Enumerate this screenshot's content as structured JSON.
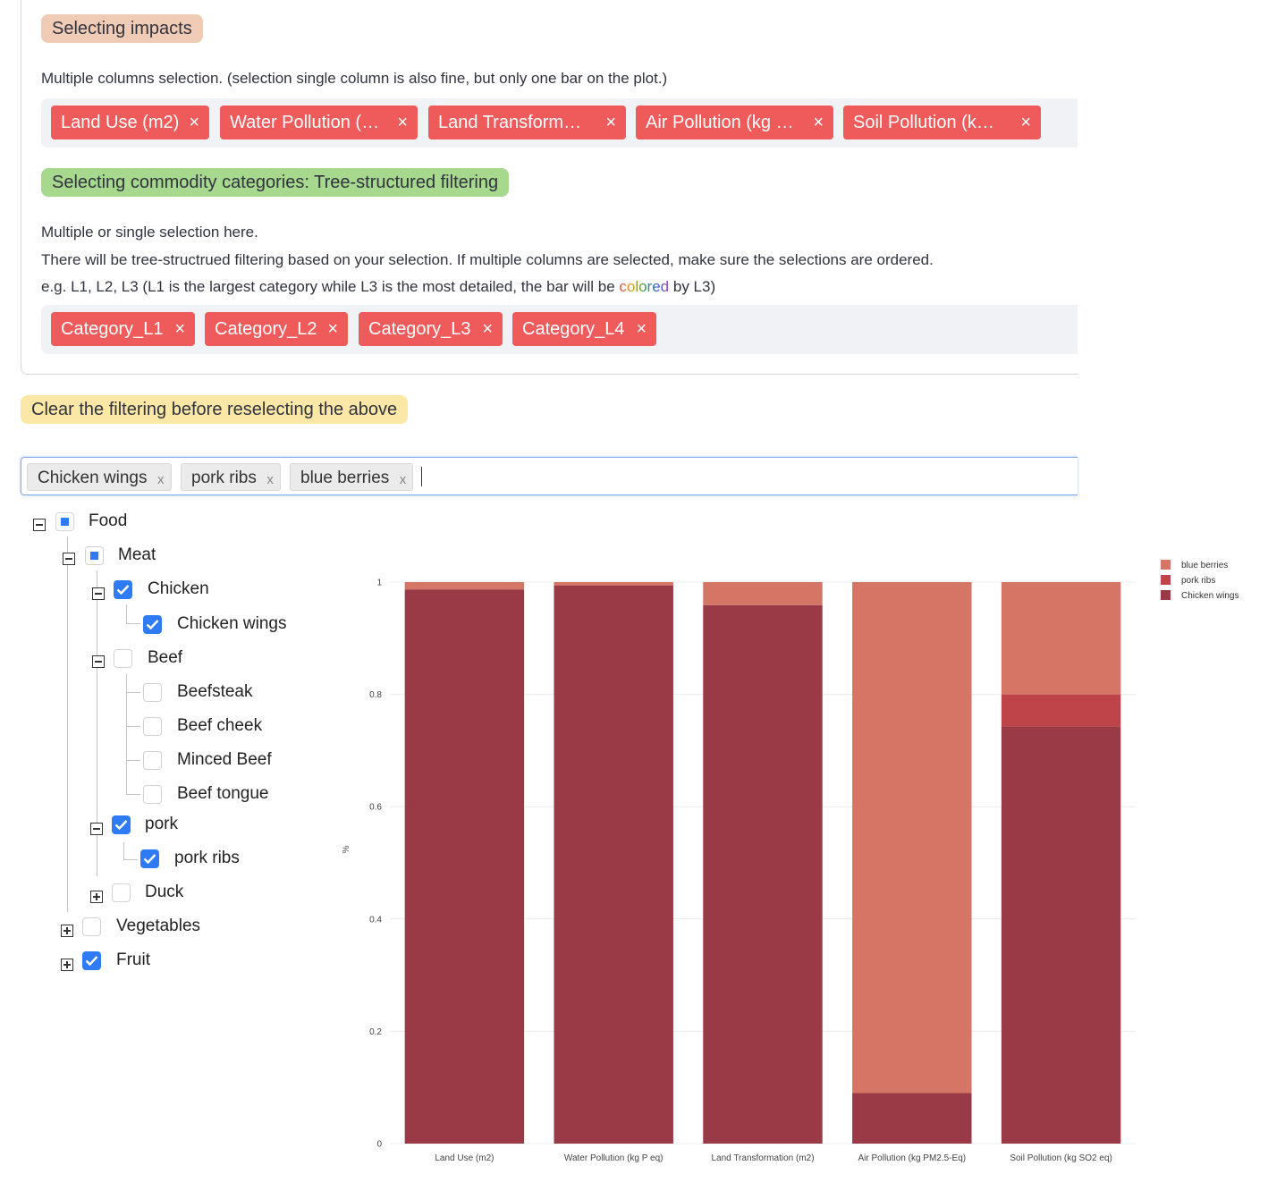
{
  "impacts_section": {
    "heading": "Selecting impacts",
    "description": "Multiple columns selection. (selection single column is also fine, but only one bar on the plot.)",
    "tags": [
      {
        "label": "Land Use (m2)"
      },
      {
        "label": "Water Pollution (…"
      },
      {
        "label": "Land Transform…"
      },
      {
        "label": "Air Pollution (kg …"
      },
      {
        "label": "Soil Pollution (k…"
      }
    ],
    "remove_glyph": "×"
  },
  "categories_section": {
    "heading": "Selecting commodity categories: Tree-structured filtering",
    "line1": "Multiple or single selection here.",
    "line2": "There will be tree-structrued filtering based on your selection. If multiple columns are selected, make sure the selections are ordered.",
    "line3_prefix": "e.g. L1, L2, L3 (L1 is the largest category while L3 is the most detailed, the bar will be ",
    "line3_colored": "colored",
    "line3_suffix": " by L3)",
    "tags": [
      {
        "label": "Category_L1"
      },
      {
        "label": "Category_L2"
      },
      {
        "label": "Category_L3"
      },
      {
        "label": "Category_L4"
      }
    ]
  },
  "filter_section": {
    "heading": "Clear the filtering before reselecting the above",
    "selected": [
      {
        "label": "Chicken wings"
      },
      {
        "label": "pork ribs"
      },
      {
        "label": "blue berries"
      }
    ],
    "remove_glyph": "x"
  },
  "tree": {
    "food": "Food",
    "meat": "Meat",
    "chicken": "Chicken",
    "chicken_wings": "Chicken wings",
    "beef": "Beef",
    "beefsteak": "Beefsteak",
    "beef_cheek": "Beef cheek",
    "minced_beef": "Minced Beef",
    "beef_tongue": "Beef tongue",
    "pork": "pork",
    "pork_ribs": "pork ribs",
    "duck": "Duck",
    "vegetables": "Vegetables",
    "fruit": "Fruit"
  },
  "colors": {
    "chicken_wings": "#9b3a47",
    "pork_ribs": "#bf4449",
    "blue_berries": "#d57566",
    "tag_red": "#ef5a5a",
    "checkbox_blue": "#2f7bf5",
    "impacts_pill": "#f0cbb5",
    "categories_pill": "#a6d88e",
    "filter_pill": "#fbe7a6"
  },
  "chart_data": {
    "type": "bar",
    "stacked": true,
    "categories": [
      "Land Use (m2)",
      "Water Pollution (kg P eq)",
      "Land Transformation (m2)",
      "Air Pollution (kg PM2.5-Eq)",
      "Soil Pollution (kg SO2 eq)"
    ],
    "series": [
      {
        "name": "Chicken wings",
        "color": "#9b3a47",
        "values": [
          0.987,
          0.994,
          0.959,
          0.09,
          0.743
        ]
      },
      {
        "name": "pork ribs",
        "color": "#bf4449",
        "values": [
          0.0,
          0.001,
          0.0,
          0.0,
          0.057
        ]
      },
      {
        "name": "blue berries",
        "color": "#d57566",
        "values": [
          0.013,
          0.005,
          0.041,
          0.91,
          0.2
        ]
      }
    ],
    "legend_order": [
      "blue berries",
      "pork ribs",
      "Chicken wings"
    ],
    "ylabel": "%",
    "ylim": [
      0,
      1
    ],
    "yticks": [
      "0",
      "0.2",
      "0.4",
      "0.6",
      "0.8",
      "1"
    ],
    "legend_position": "top-right",
    "grid": true
  }
}
